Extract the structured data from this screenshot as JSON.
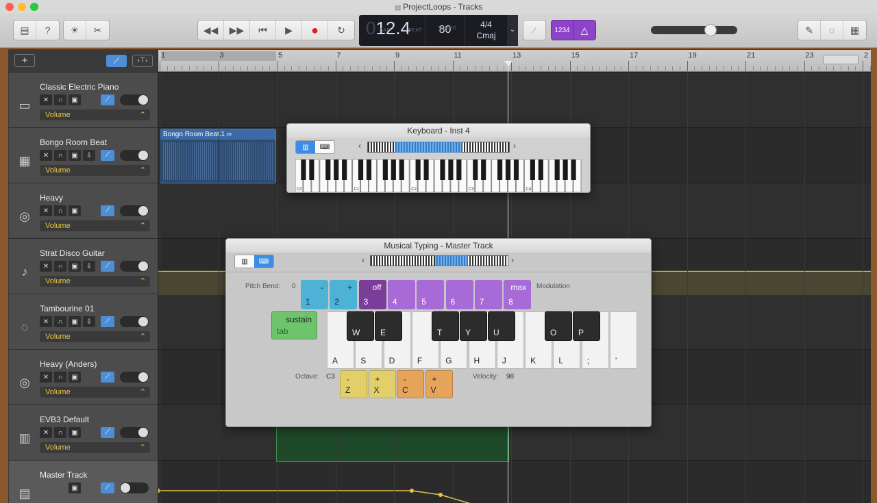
{
  "window": {
    "title": "ProjectLoops - Tracks"
  },
  "traffic": [
    {
      "name": "close",
      "color": "#ff5f57"
    },
    {
      "name": "minimize",
      "color": "#febc2e"
    },
    {
      "name": "zoom",
      "color": "#28c840"
    }
  ],
  "lcd": {
    "position": "12.4",
    "bar_label": "BAR",
    "beat_label": "BEAT",
    "tempo": "80",
    "tempo_label": "TEMPO",
    "time_sig": "4/4",
    "key": "Cmaj"
  },
  "count_in": "1234",
  "ruler": [
    "1",
    "3",
    "5",
    "7",
    "9",
    "11",
    "13",
    "15",
    "17",
    "19",
    "21",
    "23",
    "2"
  ],
  "tracks": [
    {
      "name": "Classic Electric Piano",
      "icon": "piano-icon",
      "volume": "Volume"
    },
    {
      "name": "Bongo Room Beat",
      "icon": "drum-machine-icon",
      "volume": "Volume"
    },
    {
      "name": "Heavy",
      "icon": "drum-kit-icon",
      "volume": "Volume"
    },
    {
      "name": "Strat Disco Guitar",
      "icon": "guitar-icon",
      "volume": "Volume"
    },
    {
      "name": "Tambourine 01",
      "icon": "tambourine-icon",
      "volume": "Volume"
    },
    {
      "name": "Heavy (Anders)",
      "icon": "drum-kit-icon",
      "volume": "Volume"
    },
    {
      "name": "EVB3 Default",
      "icon": "organ-icon",
      "volume": "Volume"
    },
    {
      "name": "Master Track",
      "icon": "master-icon",
      "volume": ""
    }
  ],
  "region": {
    "name": "Bongo Room Beat.1"
  },
  "keyboard_window": {
    "title": "Keyboard - Inst 4",
    "octaves": [
      "C0",
      "C1",
      "C2",
      "C3",
      "C4"
    ]
  },
  "typing_window": {
    "title": "Musical Typing - Master Track",
    "pitch_bend_label": "Pitch Bend:",
    "pitch_bend_value": "0",
    "modulation_label": "Modulation",
    "number_keys": [
      {
        "key": "1",
        "top": "-",
        "color": "#4db3d6"
      },
      {
        "key": "2",
        "top": "+",
        "color": "#4db3d6"
      },
      {
        "key": "3",
        "top": "off",
        "color": "#7a3d99"
      },
      {
        "key": "4",
        "top": "",
        "color": "#a76ad6"
      },
      {
        "key": "5",
        "top": "",
        "color": "#a76ad6"
      },
      {
        "key": "6",
        "top": "",
        "color": "#a76ad6"
      },
      {
        "key": "7",
        "top": "",
        "color": "#a76ad6"
      },
      {
        "key": "8",
        "top": "max",
        "color": "#a76ad6"
      }
    ],
    "sustain_top": "sustain",
    "sustain_key": "tab",
    "white_keys": [
      "A",
      "S",
      "D",
      "F",
      "G",
      "H",
      "J",
      "K",
      "L",
      ";",
      "'"
    ],
    "black_keys": [
      "W",
      "E",
      "T",
      "Y",
      "U",
      "O",
      "P"
    ],
    "octave_label": "Octave:",
    "octave_value": "C3",
    "octave_keys": [
      {
        "key": "Z",
        "top": "-"
      },
      {
        "key": "X",
        "top": "+"
      }
    ],
    "velocity_keys": [
      {
        "key": "C",
        "top": "-"
      },
      {
        "key": "V",
        "top": "+"
      }
    ],
    "velocity_label": "Velocity:",
    "velocity_value": "98"
  }
}
